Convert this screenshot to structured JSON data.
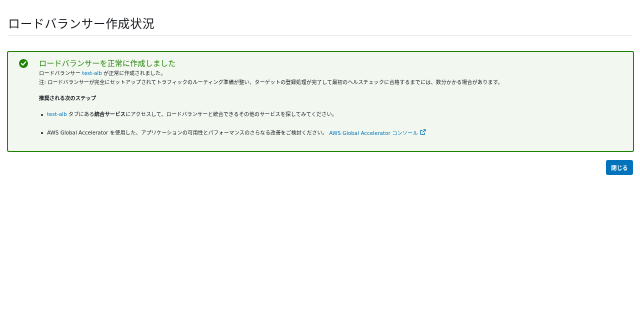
{
  "page": {
    "title": "ロードバランサー作成状況"
  },
  "alert": {
    "heading": "ロードバランサーを正常に作成しました",
    "line1_prefix": "ロードバランサー ",
    "lb_name": "test-alb",
    "line1_suffix": " が正常に作成されました。",
    "line2": "注: ロードバランサーが完全にセットアップされてトラフィックのルーティング準備が整い、ターゲットの登録処理が完了して最初のヘルスチェックに合格するまでには、数分かかる場合があります。",
    "next_steps_title": "推奨される次のステップ",
    "bullet1_link": "test-alb",
    "bullet1_mid": " タブにある",
    "bullet1_bold": "統合サービス",
    "bullet1_suffix": "にアクセスして、ロードバランサーと統合できるその他のサービスを探してみてください。",
    "bullet2_text": "AWS Global Accelerator を使用した、アプリケーションの可用性とパフォーマンスのさらなる改善をご検討ください。",
    "bullet2_link": "AWS Global Accelerator コンソール",
    "icon": "check-circle-icon",
    "external_icon": "external-link-icon"
  },
  "footer": {
    "close_label": "閉じる"
  },
  "colors": {
    "success": "#1d8102",
    "success_bg": "#f2f8f0",
    "link": "#0073bb",
    "primary_button": "#0073bb"
  }
}
